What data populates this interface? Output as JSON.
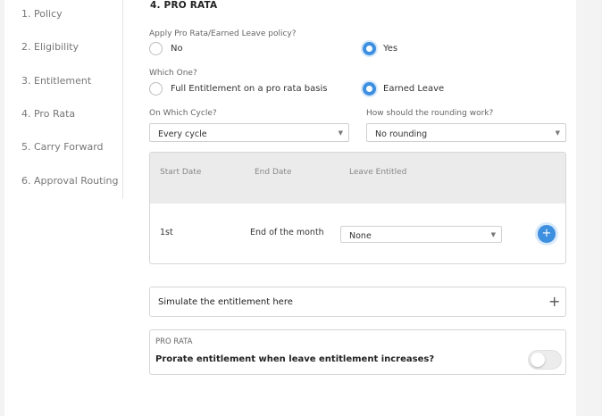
{
  "sidebar": {
    "items": [
      {
        "label": "1. Policy"
      },
      {
        "label": "2. Eligibility"
      },
      {
        "label": "3. Entitlement"
      },
      {
        "label": "4. Pro Rata"
      },
      {
        "label": "5. Carry Forward"
      },
      {
        "label": "6. Approval Routing"
      }
    ]
  },
  "section": {
    "title": "4. PRO RATA"
  },
  "apply_policy": {
    "question": "Apply Pro Rata/Earned Leave policy?",
    "options": [
      {
        "label": "No",
        "checked": false
      },
      {
        "label": "Yes",
        "checked": true
      }
    ]
  },
  "which_one": {
    "question": "Which One?",
    "options": [
      {
        "label": "Full Entitlement on a pro rata basis",
        "checked": false
      },
      {
        "label": "Earned Leave",
        "checked": true
      }
    ]
  },
  "cycle": {
    "label": "On Which Cycle?",
    "value": "Every cycle"
  },
  "rounding": {
    "label": "How should the rounding work?",
    "value": "No rounding"
  },
  "table": {
    "headers": [
      "Start Date",
      "End Date",
      "Leave Entitled"
    ],
    "rows": [
      {
        "start": "1st",
        "end": "End of the month",
        "leave": "None"
      }
    ]
  },
  "simulate": {
    "title": "Simulate the entitlement here"
  },
  "prorate": {
    "caption": "PRO RATA",
    "question": "Prorate entitlement when leave entitlement increases?",
    "enabled": false
  },
  "colors": {
    "accent": "#3d8fe0",
    "toggle_off": "#ececec"
  },
  "icons": {
    "caret": "caret-down-icon",
    "add": "plus-circle-icon",
    "expand": "plus-icon"
  }
}
